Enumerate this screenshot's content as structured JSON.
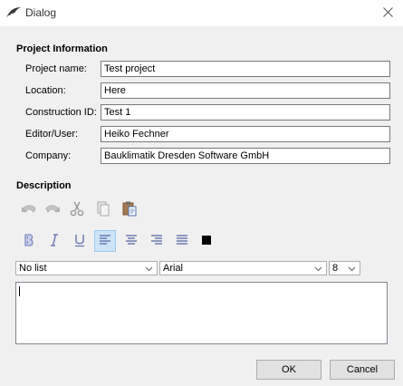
{
  "window": {
    "title": "Dialog",
    "app_icon": "bird-logo-icon",
    "close_icon": "close-icon"
  },
  "project_info": {
    "heading": "Project Information",
    "fields": [
      {
        "label": "Project name:",
        "value": "Test project"
      },
      {
        "label": "Location:",
        "value": "Here"
      },
      {
        "label": "Construction ID:",
        "value": "Test 1"
      },
      {
        "label": "Editor/User:",
        "value": "Heiko Fechner"
      },
      {
        "label": "Company:",
        "value": "Bauklimatik Dresden Software GmbH"
      }
    ]
  },
  "description": {
    "heading": "Description",
    "edit_tools": [
      "undo-icon",
      "redo-icon",
      "cut-icon",
      "copy-icon",
      "paste-icon"
    ],
    "format_tools": [
      "bold-icon",
      "italic-icon",
      "underline-icon",
      "align-left-icon",
      "align-center-icon",
      "align-right-icon",
      "align-justify-icon",
      "text-color-icon"
    ],
    "active_format": "align-left-icon",
    "list_style": "No list",
    "font_family": "Arial",
    "font_size": "8",
    "text": "",
    "text_color": "#000000"
  },
  "buttons": {
    "ok": "OK",
    "cancel": "Cancel"
  },
  "colors": {
    "background": "#f0f0f0",
    "titlebar": "#ffffff",
    "active_tool": "#cce4f7",
    "format_icons": "#6d7bb3"
  }
}
